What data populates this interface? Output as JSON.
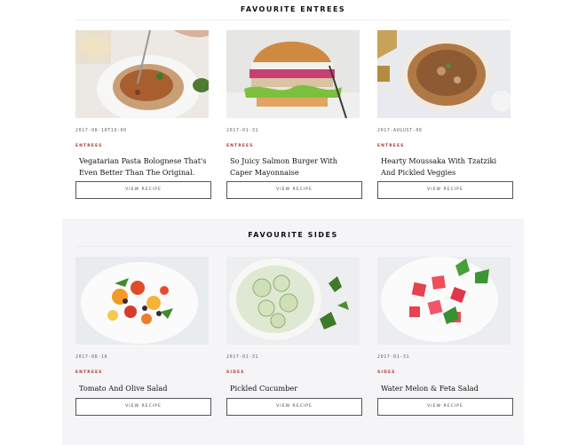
{
  "entrees": {
    "title": "FAVOURITE ENTREES",
    "cards": [
      {
        "date": "2017-08-10T19:00",
        "category": "ENTREES",
        "title": "Vegatarian Pasta Bolognese That's Even Better Than The Original.",
        "button": "VIEW RECIPE"
      },
      {
        "date": "2017-01-31",
        "category": "ENTREES",
        "title": "So Juicy Salmon Burger With Caper Mayonnaise",
        "button": "VIEW RECIPE"
      },
      {
        "date": "2017-AUGUST-08",
        "category": "ENTREES",
        "title": "Hearty Moussaka With Tzatziki And Pickled Veggies",
        "button": "VIEW RECIPE"
      }
    ]
  },
  "sides": {
    "title": "FAVOURITE SIDES",
    "cards": [
      {
        "date": "2017-08-10",
        "category": "ENTREES",
        "title": "Tomato And Olive Salad",
        "button": "VIEW RECIPE"
      },
      {
        "date": "2017-01-31",
        "category": "SIDES",
        "title": "Pickled Cucumber",
        "button": "VIEW RECIPE"
      },
      {
        "date": "2017-01-31",
        "category": "SIDES",
        "title": "Water Melon & Feta Salad",
        "button": "VIEW RECIPE"
      }
    ]
  },
  "colors": {
    "category": "#b23a2f",
    "sides_background": "#f5f5f8"
  }
}
